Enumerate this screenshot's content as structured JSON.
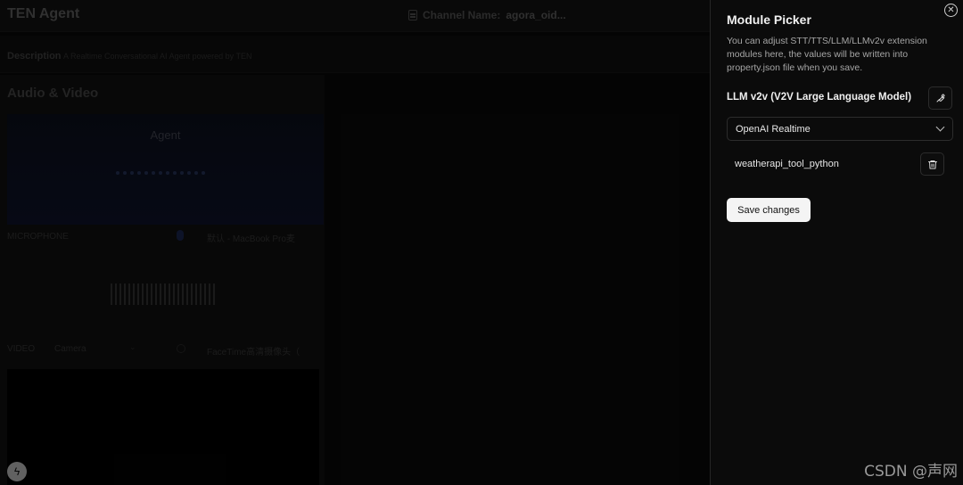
{
  "app": {
    "title": "TEN Agent",
    "channel_label": "Channel Name:",
    "channel_value": "agora_oid...",
    "description_label": "Description",
    "description_text": "A Realtime Conversational AI Agent powered by TEN",
    "section_title": "Audio & Video",
    "agent_name": "Agent",
    "microphone_label": "MICROPHONE",
    "microphone_device": "默认 - MacBook Pro麦",
    "video_label": "VIDEO",
    "camera_select": "Camera",
    "camera_device": "FaceTime高清摄像头（"
  },
  "sheet": {
    "title": "Module Picker",
    "description": "You can adjust STT/TTS/LLM/LLMv2v extension modules here, the values will be written into property.json file when you save.",
    "module_label": "LLM v2v (V2V Large Language Model)",
    "selected_module": "OpenAI Realtime",
    "tool_name": "weatherapi_tool_python",
    "save_label": "Save changes",
    "close_glyph": "✕"
  },
  "icons": {
    "close": "close-icon",
    "wrench": "wrench-icon",
    "chevron": "chevron-down-icon",
    "trash": "trash-icon",
    "bolt": "bolt-icon"
  },
  "watermark": "CSDN @声网",
  "colors": {
    "sheet_bg": "#0b0b0b",
    "save_button_bg": "#f4f4f4",
    "agent_gradient": "#101630"
  }
}
